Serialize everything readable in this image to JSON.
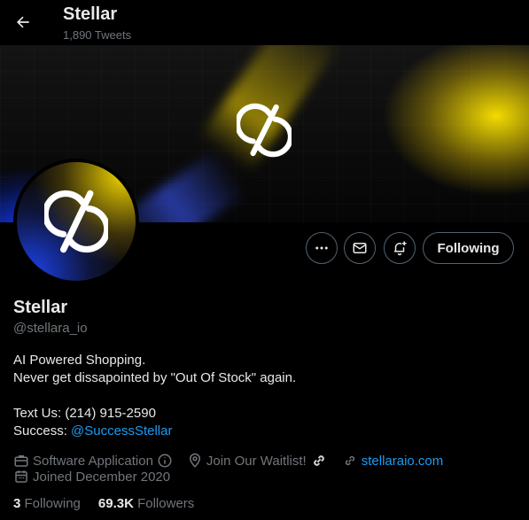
{
  "header": {
    "title": "Stellar",
    "subtitle": "1,890 Tweets"
  },
  "profile": {
    "name": "Stellar",
    "handle": "@stellara_io",
    "bio_line1": "AI Powered Shopping.",
    "bio_line2": "Never get dissapointed by \"Out Of Stock\" again.",
    "contact_line": "Text Us: (214) 915-2590",
    "success_prefix": "Success: ",
    "success_link": "@SuccessStellar"
  },
  "actions": {
    "follow_label": "Following"
  },
  "meta": {
    "category": "Software Application",
    "location": "Join Our Waitlist!",
    "website": "stellaraio.com",
    "joined": "Joined December 2020"
  },
  "stats": {
    "following_count": "3",
    "following_label": "Following",
    "followers_count": "69.3K",
    "followers_label": "Followers"
  },
  "colors": {
    "accent": "#1d9bf0",
    "muted": "#71767b",
    "text": "#e7e9ea",
    "background": "#000000",
    "border": "#536471"
  },
  "icons": [
    "back-arrow-icon",
    "more-icon",
    "message-icon",
    "notification-bell-icon",
    "briefcase-icon",
    "info-icon",
    "location-pin-icon",
    "chain-link-icon",
    "website-link-icon",
    "calendar-icon",
    "stellar-logo-icon"
  ]
}
